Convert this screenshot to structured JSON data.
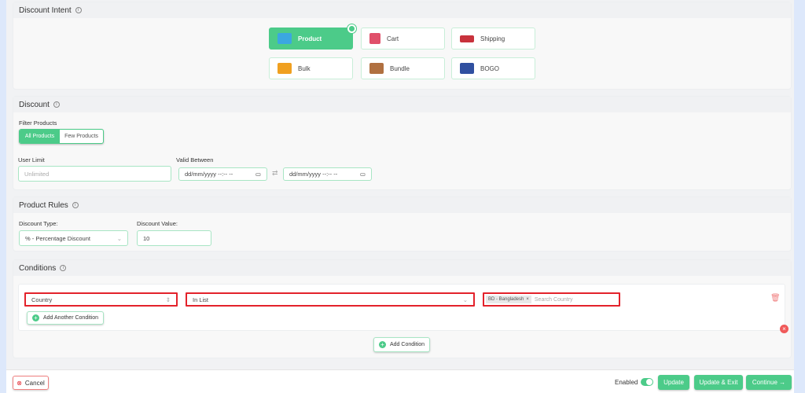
{
  "intent": {
    "title": "Discount Intent",
    "options": [
      {
        "label": "Product",
        "icon": "box-icon",
        "selected": true
      },
      {
        "label": "Cart",
        "icon": "cart-icon"
      },
      {
        "label": "Shipping",
        "icon": "truck-icon"
      },
      {
        "label": "Bulk",
        "icon": "boxes-icon"
      },
      {
        "label": "Bundle",
        "icon": "bundle-icon"
      },
      {
        "label": "BOGO",
        "icon": "bogo-icon"
      }
    ]
  },
  "discount": {
    "title": "Discount",
    "filter_label": "Filter Products",
    "filter_options": [
      "All Products",
      "Few Products"
    ],
    "filter_selected": "All Products",
    "user_limit_label": "User Limit",
    "user_limit_placeholder": "Unlimited",
    "valid_label": "Valid Between",
    "date_placeholder": "dd/mm/yyyy --:-- --"
  },
  "rules": {
    "title": "Product Rules",
    "type_label": "Discount Type:",
    "type_value": "% - Percentage Discount",
    "value_label": "Discount Value:",
    "value": "10"
  },
  "conditions": {
    "title": "Conditions",
    "field": "Country",
    "operator": "In List",
    "tag": "BD - Bangladesh",
    "search_placeholder": "Search Country",
    "add_another": "Add Another Condition",
    "add_condition": "Add Condition"
  },
  "footer": {
    "cancel": "Cancel",
    "enabled_label": "Enabled",
    "enabled": true,
    "update": "Update",
    "update_exit": "Update & Exit",
    "continue": "Continue →"
  },
  "colors": {
    "accent": "#4ccb89",
    "error": "#e3222b"
  }
}
